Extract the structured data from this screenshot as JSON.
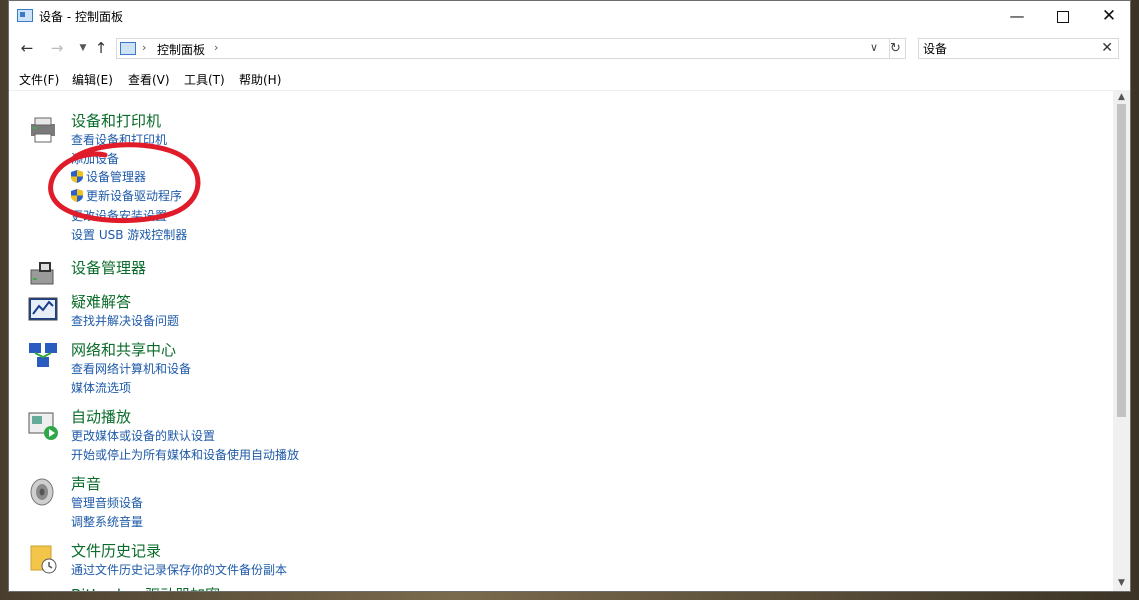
{
  "window": {
    "title": "设备 - 控制面板"
  },
  "nav": {
    "breadcrumb": [
      "控制面板"
    ],
    "search_value": "设备"
  },
  "menu": [
    "文件(F)",
    "编辑(E)",
    "查看(V)",
    "工具(T)",
    "帮助(H)"
  ],
  "categories": [
    {
      "title": "设备和打印机",
      "icon": "printer-icon",
      "links": [
        "查看设备和打印机",
        "添加设备",
        "设备管理器",
        "更新设备驱动程序",
        "更改设备安装设置",
        "设置 USB 游戏控制器"
      ]
    },
    {
      "title": "设备管理器",
      "icon": "device-manager-icon",
      "links": []
    },
    {
      "title": "疑难解答",
      "icon": "troubleshoot-icon",
      "links": [
        "查找并解决设备问题"
      ]
    },
    {
      "title": "网络和共享中心",
      "icon": "network-icon",
      "links": [
        "查看网络计算机和设备",
        "媒体流选项"
      ]
    },
    {
      "title": "自动播放",
      "icon": "autoplay-icon",
      "links": [
        "更改媒体或设备的默认设置",
        "开始或停止为所有媒体和设备使用自动播放"
      ]
    },
    {
      "title": "声音",
      "icon": "speaker-icon",
      "links": [
        "管理音频设备",
        "调整系统音量"
      ]
    },
    {
      "title": "文件历史记录",
      "icon": "file-history-icon",
      "links": [
        "通过文件历史记录保存你的文件备份副本"
      ]
    }
  ],
  "partial_last_row": "BitLocker 驱动器加密",
  "colors": {
    "category_title": "#0a6b2a",
    "link": "#1e5aa8",
    "annotation": "#e01b2a"
  }
}
